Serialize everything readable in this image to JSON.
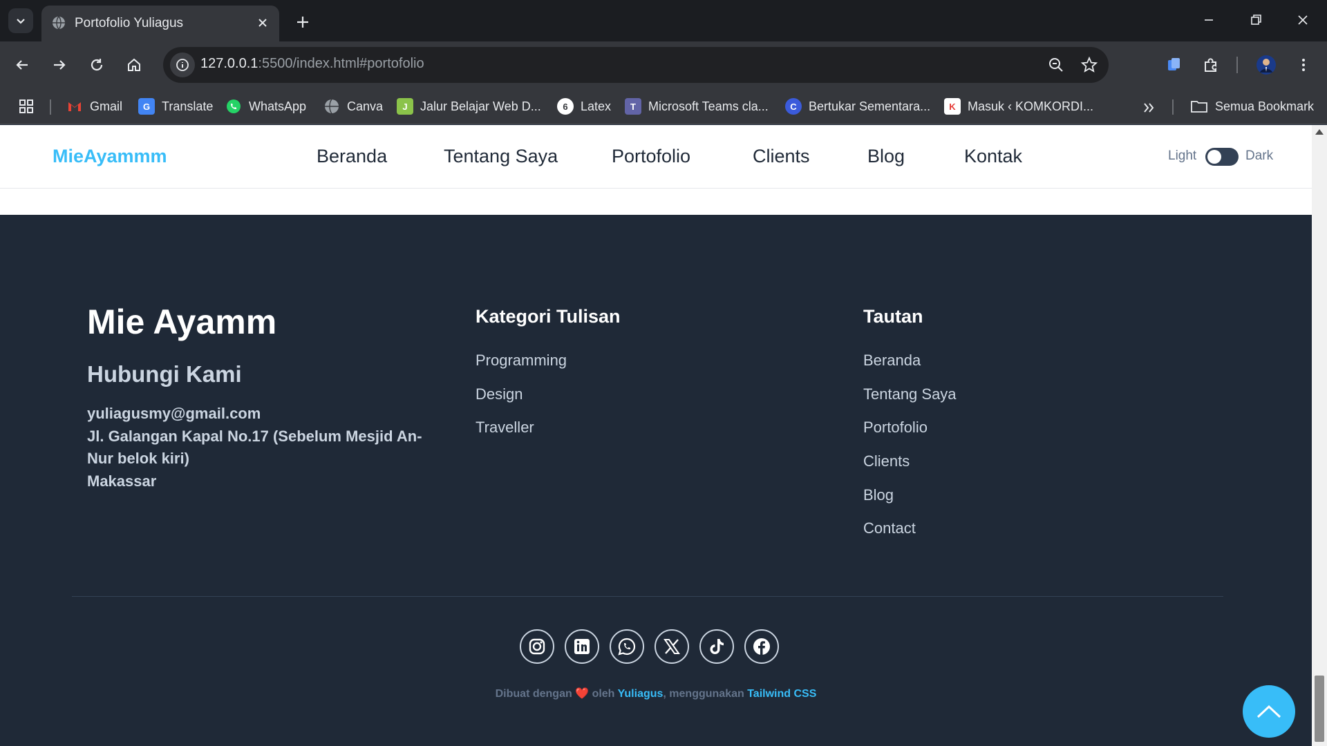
{
  "browser": {
    "tab_title": "Portofolio Yuliagus",
    "url_host": "127.0.0.1",
    "url_rest": ":5500/index.html#portofolio",
    "bookmarks": [
      {
        "label": "Gmail",
        "icon": "gmail-icon",
        "color": "#ea4335"
      },
      {
        "label": "Translate",
        "icon": "translate-icon",
        "color": "#4285f4"
      },
      {
        "label": "WhatsApp",
        "icon": "whatsapp-icon",
        "color": "#25d366"
      },
      {
        "label": "Canva",
        "icon": "globe-icon",
        "color": "#9aa0a6"
      },
      {
        "label": "Jalur Belajar Web D...",
        "icon": "learning-path-icon",
        "color": "#8bc34a"
      },
      {
        "label": "Latex",
        "icon": "latex-icon",
        "color": "#ffffff"
      },
      {
        "label": "Microsoft Teams cla...",
        "icon": "teams-icon",
        "color": "#6264a7"
      },
      {
        "label": "Bertukar Sementara...",
        "icon": "bertukar-icon",
        "color": "#3b5bdb"
      },
      {
        "label": "Masuk ‹ KOMKORDI...",
        "icon": "komkordi-icon",
        "color": "#e53935"
      }
    ],
    "all_bookmarks": "Semua Bookmark"
  },
  "header": {
    "brand": "MieAyammm",
    "nav": [
      "Beranda",
      "Tentang Saya",
      "Portofolio",
      "Clients",
      "Blog",
      "Kontak"
    ],
    "toggle_light": "Light",
    "toggle_dark": "Dark"
  },
  "footer": {
    "brand": "Mie Ayamm",
    "contact_title": "Hubungi Kami",
    "email": "yuliagusmy@gmail.com",
    "address": "Jl. Galangan Kapal No.17 (Sebelum Mesjid An-Nur belok kiri)",
    "city": "Makassar",
    "categories_title": "Kategori Tulisan",
    "categories": [
      "Programming",
      "Design",
      "Traveller"
    ],
    "links_title": "Tautan",
    "links": [
      "Beranda",
      "Tentang Saya",
      "Portofolio",
      "Clients",
      "Blog",
      "Contact"
    ],
    "social": [
      "instagram-icon",
      "linkedin-icon",
      "whatsapp-icon",
      "x-icon",
      "tiktok-icon",
      "facebook-icon"
    ],
    "credit_prefix": "Dibuat dengan",
    "credit_heart": "❤️",
    "credit_by": "oleh",
    "credit_author": "Yuliagus",
    "credit_using": ", menggunakan",
    "credit_tool": "Tailwind CSS"
  },
  "colors": {
    "accent": "#38bdf8",
    "footer_bg": "#1f2937",
    "chrome_bg": "#35373c"
  }
}
